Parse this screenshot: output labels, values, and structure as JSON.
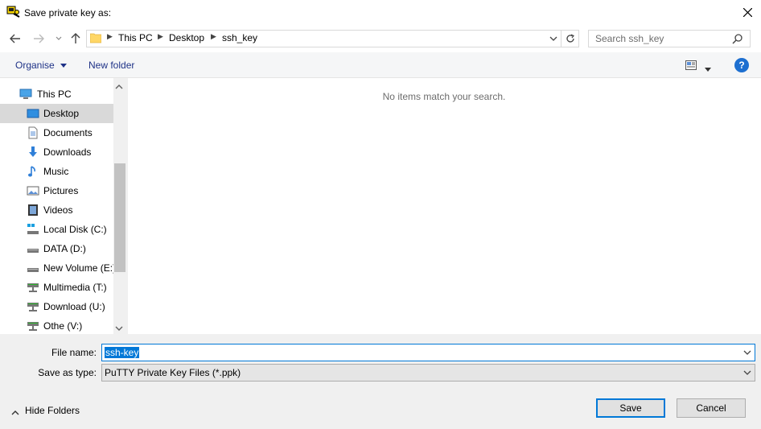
{
  "window": {
    "title": "Save private key as:"
  },
  "nav": {
    "breadcrumb": [
      "This PC",
      "Desktop",
      "ssh_key"
    ],
    "search_placeholder": "Search ssh_key"
  },
  "toolbar": {
    "organise": "Organise",
    "new_folder": "New folder",
    "help": "?"
  },
  "tree": {
    "items": [
      {
        "label": "This PC",
        "icon": "computer-icon",
        "level": 0
      },
      {
        "label": "Desktop",
        "icon": "desktop-icon",
        "level": 1,
        "selected": true
      },
      {
        "label": "Documents",
        "icon": "documents-icon",
        "level": 1
      },
      {
        "label": "Downloads",
        "icon": "downloads-icon",
        "level": 1
      },
      {
        "label": "Music",
        "icon": "music-icon",
        "level": 1
      },
      {
        "label": "Pictures",
        "icon": "pictures-icon",
        "level": 1
      },
      {
        "label": "Videos",
        "icon": "videos-icon",
        "level": 1
      },
      {
        "label": "Local Disk (C:)",
        "icon": "local-disk-icon",
        "level": 1
      },
      {
        "label": "DATA (D:)",
        "icon": "drive-icon",
        "level": 1
      },
      {
        "label": "New Volume (E:)",
        "icon": "drive-icon",
        "level": 1
      },
      {
        "label": "Multimedia (T:)",
        "icon": "network-drive-icon",
        "level": 1
      },
      {
        "label": "Download (U:)",
        "icon": "network-drive-icon",
        "level": 1
      },
      {
        "label": "Othe (V:)",
        "icon": "network-drive-icon",
        "level": 1
      }
    ]
  },
  "content": {
    "empty_message": "No items match your search."
  },
  "form": {
    "file_name_label": "File name:",
    "file_name_value": "ssh-key",
    "save_type_label": "Save as type:",
    "save_type_value": "PuTTY Private Key Files (*.ppk)"
  },
  "footer": {
    "hide_folders": "Hide Folders",
    "save": "Save",
    "cancel": "Cancel"
  },
  "colors": {
    "accent": "#0078d7",
    "toolbar_link": "#1e3287",
    "selection": "#d9d9d9"
  }
}
